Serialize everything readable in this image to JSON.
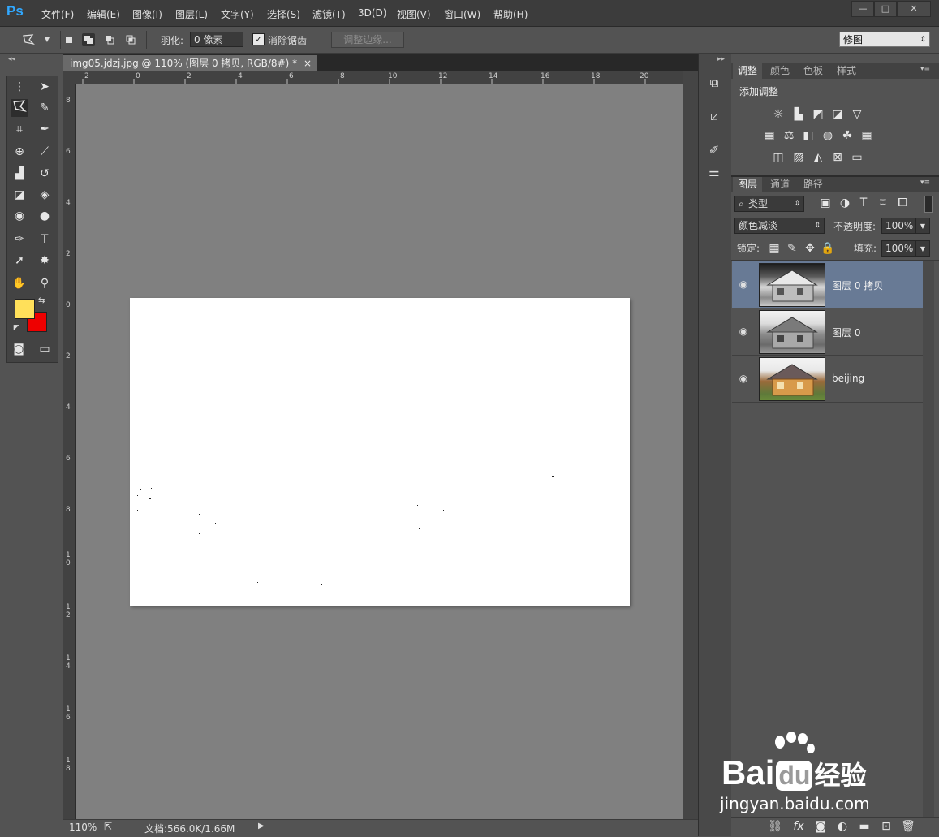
{
  "app": {
    "logo": "Ps"
  },
  "menu": [
    "文件(F)",
    "编辑(E)",
    "图像(I)",
    "图层(L)",
    "文字(Y)",
    "选择(S)",
    "滤镜(T)",
    "3D(D)",
    "视图(V)",
    "窗口(W)",
    "帮助(H)"
  ],
  "window_controls": {
    "minimize": "—",
    "maximize": "□",
    "close": "✕"
  },
  "options": {
    "feather_label": "羽化:",
    "feather_value": "0 像素",
    "antialias_label": "消除锯齿",
    "antialias_checked": true,
    "refine_edge_label": "调整边缘...",
    "workspace": "修图"
  },
  "document": {
    "tab_title": "img05.jdzj.jpg @ 110% (图层 0 拷贝, RGB/8#) *",
    "tab_close": "×",
    "ruler_h": [
      "2",
      "0",
      "2",
      "4",
      "6",
      "8",
      "10",
      "12",
      "14",
      "16",
      "18",
      "20"
    ],
    "ruler_v": [
      "8",
      "6",
      "4",
      "2",
      "0",
      "2",
      "4",
      "6",
      "8",
      "1 0",
      "1 2",
      "1 4",
      "1 6",
      "1 8"
    ],
    "zoom": "110%",
    "doc_size": "文档:566.0K/1.66M"
  },
  "colors": {
    "foreground": "#ffe05a",
    "background": "#ee0000",
    "selected_layer": "#687a95"
  },
  "adjustments_panel": {
    "tabs": [
      "调整",
      "颜色",
      "色板",
      "样式"
    ],
    "active_tab": "调整",
    "title": "添加调整"
  },
  "layers_panel": {
    "tabs": [
      "图层",
      "通道",
      "路径"
    ],
    "active_tab": "图层",
    "filter_kind": "类型",
    "blend_mode": "颜色减淡",
    "opacity_label": "不透明度:",
    "opacity_value": "100%",
    "lock_label": "锁定:",
    "fill_label": "填充:",
    "fill_value": "100%",
    "layers": [
      {
        "name": "图层 0 拷贝",
        "visible": true,
        "selected": true,
        "thumbnail": "grayscale-edges"
      },
      {
        "name": "图层 0",
        "visible": true,
        "selected": false,
        "thumbnail": "grayscale"
      },
      {
        "name": "beijing",
        "visible": true,
        "selected": false,
        "thumbnail": "color"
      }
    ]
  },
  "watermark": {
    "brand": "Bai",
    "brand_suffix": "du",
    "brand_cn": "经验",
    "url": "jingyan.baidu.com"
  }
}
